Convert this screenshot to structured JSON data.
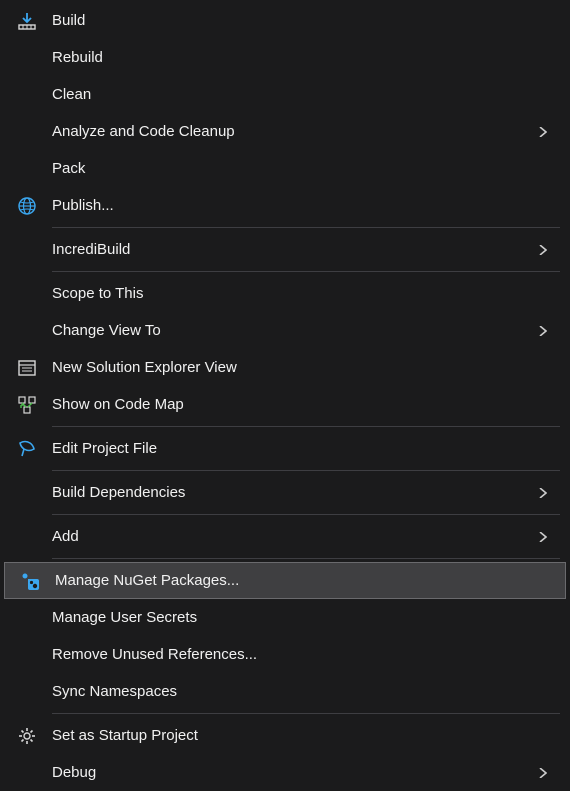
{
  "menu": {
    "items": [
      {
        "label": "Build",
        "icon": "build-download-icon",
        "has_submenu": false
      },
      {
        "label": "Rebuild",
        "icon": null,
        "has_submenu": false
      },
      {
        "label": "Clean",
        "icon": null,
        "has_submenu": false
      },
      {
        "label": "Analyze and Code Cleanup",
        "icon": null,
        "has_submenu": true
      },
      {
        "label": "Pack",
        "icon": null,
        "has_submenu": false
      },
      {
        "label": "Publish...",
        "icon": "globe-icon",
        "has_submenu": false
      },
      {
        "separator": true
      },
      {
        "label": "IncrediBuild",
        "icon": null,
        "has_submenu": true
      },
      {
        "separator": true
      },
      {
        "label": "Scope to This",
        "icon": null,
        "has_submenu": false
      },
      {
        "label": "Change View To",
        "icon": null,
        "has_submenu": true
      },
      {
        "label": "New Solution Explorer View",
        "icon": "solution-explorer-icon",
        "has_submenu": false
      },
      {
        "label": "Show on Code Map",
        "icon": "code-map-icon",
        "has_submenu": false
      },
      {
        "separator": true
      },
      {
        "label": "Edit Project File",
        "icon": "edit-file-icon",
        "has_submenu": false
      },
      {
        "separator": true
      },
      {
        "label": "Build Dependencies",
        "icon": null,
        "has_submenu": true
      },
      {
        "separator": true
      },
      {
        "label": "Add",
        "icon": null,
        "has_submenu": true
      },
      {
        "separator": true
      },
      {
        "label": "Manage NuGet Packages...",
        "icon": "nuget-icon",
        "has_submenu": false,
        "highlighted": true
      },
      {
        "label": "Manage User Secrets",
        "icon": null,
        "has_submenu": false
      },
      {
        "label": "Remove Unused References...",
        "icon": null,
        "has_submenu": false
      },
      {
        "label": "Sync Namespaces",
        "icon": null,
        "has_submenu": false
      },
      {
        "separator": true
      },
      {
        "label": "Set as Startup Project",
        "icon": "gear-icon",
        "has_submenu": false
      },
      {
        "label": "Debug",
        "icon": null,
        "has_submenu": true
      }
    ]
  }
}
